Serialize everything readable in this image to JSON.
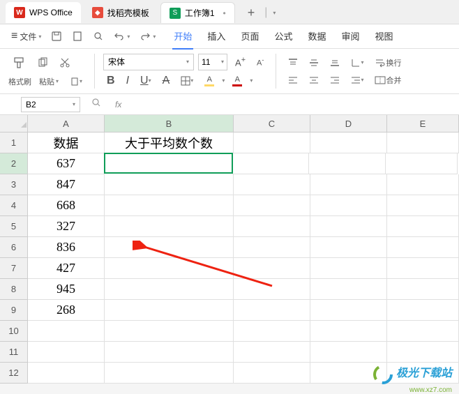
{
  "titlebar": {
    "app_name": "WPS Office",
    "template_tab": "找稻壳模板",
    "doc_tab": "工作簿1",
    "doc_badge": "S"
  },
  "menubar": {
    "file": "文件",
    "tabs": [
      "开始",
      "插入",
      "页面",
      "公式",
      "数据",
      "审阅",
      "视图"
    ],
    "active_index": 0
  },
  "ribbon": {
    "format_painter": "格式刷",
    "paste": "粘贴",
    "font_name": "宋体",
    "font_size": "11",
    "wrap": "换行",
    "merge": "合并"
  },
  "namebox": {
    "cell_ref": "B2",
    "fx": "fx"
  },
  "sheet": {
    "columns": [
      "A",
      "B",
      "C",
      "D",
      "E"
    ],
    "row_labels": [
      "1",
      "2",
      "3",
      "4",
      "5",
      "6",
      "7",
      "8",
      "9",
      "10",
      "11",
      "12"
    ],
    "header_a": "数据",
    "header_b": "大于平均数个数",
    "data_a": [
      "637",
      "847",
      "668",
      "327",
      "836",
      "427",
      "945",
      "268"
    ]
  },
  "watermark": {
    "line1": "极光下载站",
    "line2": "www.xz7.com"
  }
}
